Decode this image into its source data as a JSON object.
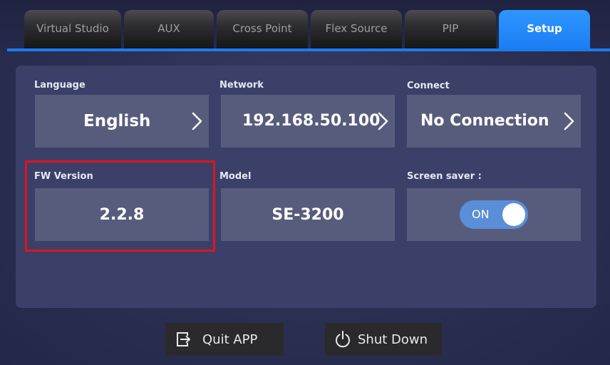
{
  "tabs": [
    {
      "label": "Virtual Studio",
      "active": false
    },
    {
      "label": "AUX",
      "active": false
    },
    {
      "label": "Cross Point",
      "active": false
    },
    {
      "label": "Flex Source",
      "active": false
    },
    {
      "label": "PIP",
      "active": false
    },
    {
      "label": "Setup",
      "active": true
    }
  ],
  "setup": {
    "language": {
      "label": "Language",
      "value": "English"
    },
    "network": {
      "label": "Network",
      "value": "192.168.50.100"
    },
    "connect": {
      "label": "Connect",
      "value": "No Connection"
    },
    "fw_version": {
      "label": "FW Version",
      "value": "2.2.8"
    },
    "model": {
      "label": "Model",
      "value": "SE-3200"
    },
    "screen_saver": {
      "label": "Screen saver :",
      "state": "ON"
    }
  },
  "actions": {
    "quit_label": "Quit APP",
    "shutdown_label": "Shut Down"
  },
  "icons": {
    "quit": "exit-icon",
    "shutdown": "power-icon",
    "chevron": "chevron-right-icon"
  },
  "colors": {
    "active_tab": "#1a7df3",
    "highlight": "#e0141e",
    "toggle_on": "#5b8ed8"
  }
}
